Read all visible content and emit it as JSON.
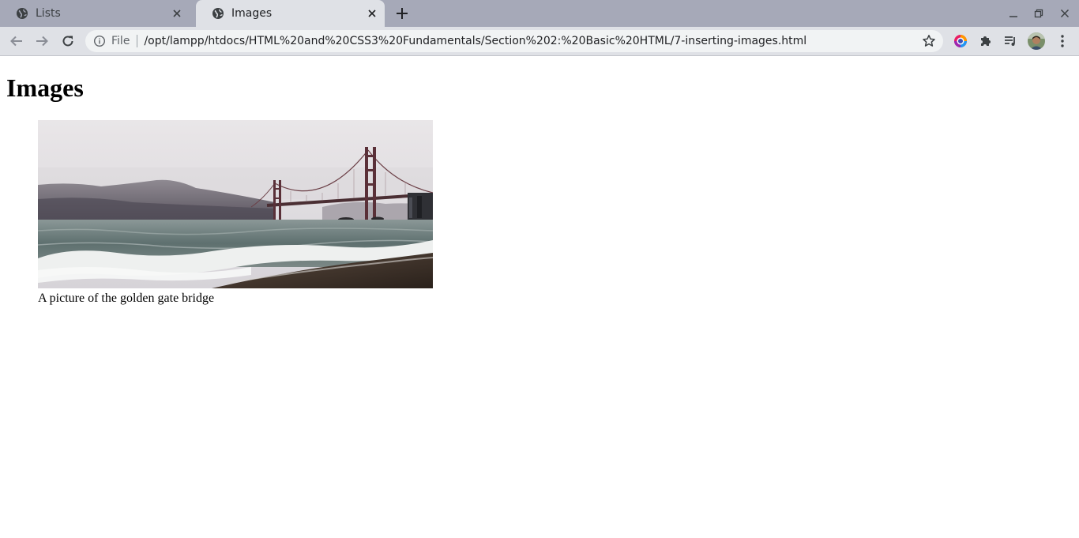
{
  "browser": {
    "tabs": [
      {
        "title": "Lists",
        "active": false
      },
      {
        "title": "Images",
        "active": true
      }
    ],
    "address_bar": {
      "scheme_label": "File",
      "url": "/opt/lampp/htdocs/HTML%20and%20CSS3%20Fundamentals/Section%202:%20Basic%20HTML/7-inserting-images.html"
    },
    "colors": {
      "tabstrip": "#a6a9b8",
      "toolbar": "#dfe1e6",
      "omnibox": "#f1f3f4"
    }
  },
  "page": {
    "heading": "Images",
    "figure": {
      "image_alt": "golden gate bridge",
      "caption": "A picture of the golden gate bridge"
    }
  }
}
